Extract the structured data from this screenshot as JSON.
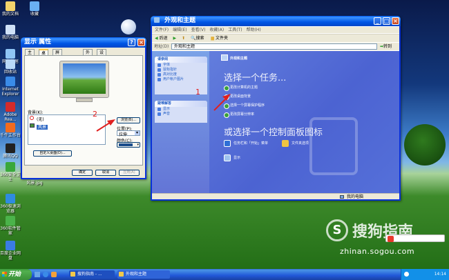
{
  "desktop_icons": [
    {
      "label": "我的文档",
      "color": "#f3d36b"
    },
    {
      "label": "收藏",
      "color": "#6ab0f3"
    },
    {
      "label": "我的电脑",
      "color": "#cfe1f7"
    },
    {
      "label": "网上邻居",
      "color": "#8fc5f5"
    },
    {
      "label": "回收站",
      "color": "#b9d9f7"
    },
    {
      "label": "Internet Explorer",
      "color": "#3a8be8"
    },
    {
      "label": "Adobe Rea...",
      "color": "#d32b2b"
    },
    {
      "label": "千牛工作台",
      "color": "#f26b1e"
    },
    {
      "label": "腾讯QQ",
      "color": "#222222"
    },
    {
      "label": "360安全卫士",
      "color": "#39a83b"
    },
    {
      "label": "风景.jpg",
      "color": "#6fa8dc"
    },
    {
      "label": "360极速浏览器",
      "color": "#2f8be0"
    },
    {
      "label": "360软件管家",
      "color": "#4bb34a"
    },
    {
      "label": "百度企业网盘",
      "color": "#3a7ce3"
    }
  ],
  "props": {
    "title": "显示 属性",
    "tabs": [
      "主题",
      "桌面",
      "屏幕保护程序",
      "外观",
      "设置"
    ],
    "bg_label": "背景(K):",
    "bg_items": [
      "(无)",
      "风景"
    ],
    "browse": "浏览(B)...",
    "pos_label": "位置(P):",
    "pos_value": "拉伸",
    "color_label": "颜色(C):",
    "custom": "自定义桌面(D)...",
    "ok": "确定",
    "cancel": "取消",
    "apply": "应用(A)",
    "annotation": "2"
  },
  "explorer": {
    "title": "外观和主题",
    "menus": [
      "文件(F)",
      "编辑(E)",
      "查看(V)",
      "收藏(A)",
      "工具(T)",
      "帮助(H)"
    ],
    "back": "后退",
    "search": "搜索",
    "folders": "文件夹",
    "address_label": "地址(D)",
    "address_value": "外观和主题",
    "go": "转到",
    "see_also": "请参阅",
    "see_also_items": [
      "字体",
      "鼠标指针",
      "高对比度",
      "用户帐户图片"
    ],
    "troubleshoot": "疑难解答",
    "troubleshoot_items": [
      "显示",
      "声音"
    ],
    "header": "外观和主题",
    "pick_task": "选择一个任务...",
    "tasks": [
      "更改计算机的主题",
      "更改桌面背景",
      "选择一个屏幕保护程序",
      "更改屏幕分辨率"
    ],
    "or_pick": "或选择一个控制面板图标",
    "cp_items": [
      "任务栏和「开始」菜单",
      "文件夹选项",
      "显示"
    ],
    "status": "我的电脑",
    "annotation": "1"
  },
  "watermark": {
    "brand": "搜狗指南",
    "url": "zhinan.sogou.com"
  },
  "taskbar": {
    "start": "开始",
    "items": [
      "搜狗指南 - ...",
      "外观和主题"
    ],
    "clock": "14:14"
  }
}
